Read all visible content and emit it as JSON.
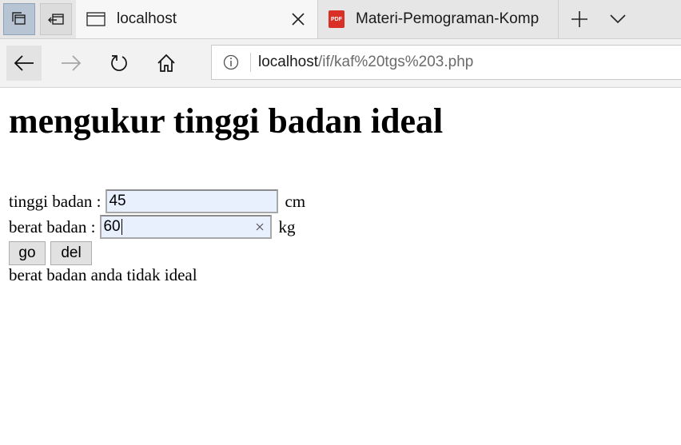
{
  "browser": {
    "tabs": [
      {
        "title": "localhost",
        "active": true
      },
      {
        "title": "Materi-Pemograman-Komp",
        "active": false,
        "icon": "pdf-icon"
      }
    ],
    "pdf_badge_text": "PDF",
    "address": {
      "host": "localhost",
      "path": "/if/kaf%20tgs%203.php"
    },
    "colors": {
      "tabbar": "#e6e6e6",
      "active_tab": "#f7f7f7",
      "pdf_red": "#d93025",
      "field_autofill": "#e8f0fe"
    }
  },
  "page": {
    "heading": "mengukur tinggi badan ideal",
    "height_label": "tinggi badan :",
    "height_value": "45",
    "height_unit": "cm",
    "weight_label": "berat badan :",
    "weight_value": "60",
    "weight_unit": "kg",
    "go_label": "go",
    "del_label": "del",
    "result": "berat badan anda tidak ideal"
  }
}
